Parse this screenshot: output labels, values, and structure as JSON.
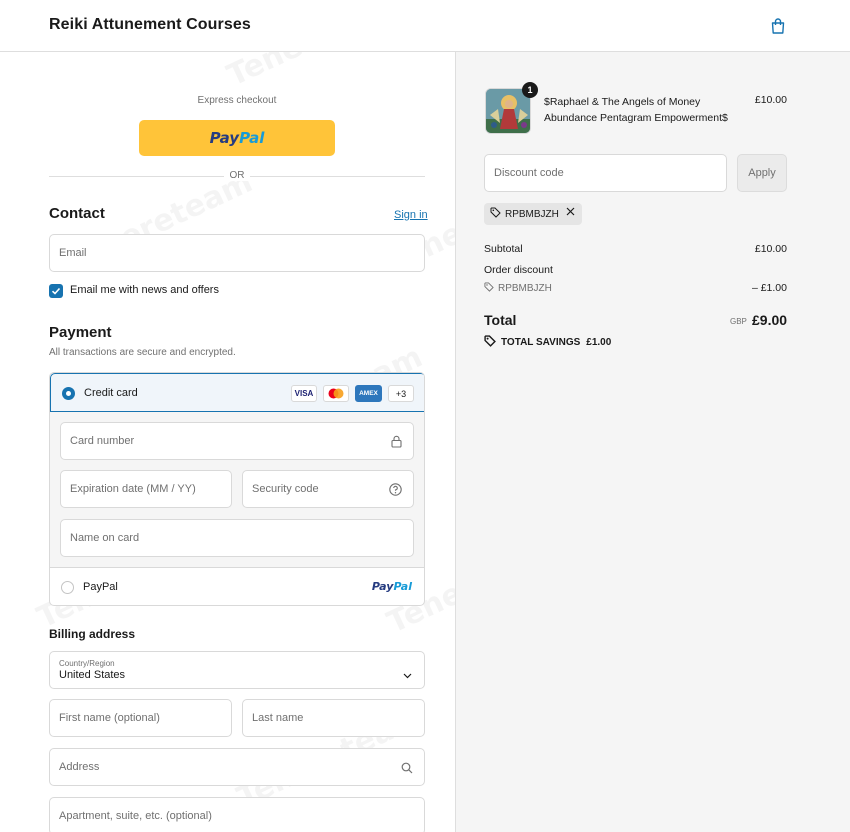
{
  "header": {
    "store_title": "Reiki Attunement Courses",
    "cart_icon": "shopping-bag-icon"
  },
  "express": {
    "label": "Express checkout",
    "paypal_part1": "Pay",
    "paypal_part2": "Pal",
    "or_text": "OR"
  },
  "contact": {
    "heading": "Contact",
    "signin_label": "Sign in",
    "email_placeholder": "Email",
    "newsletter_label": "Email me with news and offers",
    "newsletter_checked": true
  },
  "payment": {
    "heading": "Payment",
    "subtitle": "All transactions are secure and encrypted.",
    "credit_card_label": "Credit card",
    "card_logos": [
      "VISA",
      "AMEX"
    ],
    "more_cards": "+3",
    "card_number_placeholder": "Card number",
    "expiry_placeholder": "Expiration date (MM / YY)",
    "security_placeholder": "Security code",
    "name_placeholder": "Name on card",
    "paypal_label": "PayPal",
    "paypal_logo_part1": "Pay",
    "paypal_logo_part2": "Pal"
  },
  "billing": {
    "heading": "Billing address",
    "country_label": "Country/Region",
    "country_value": "United States",
    "first_name_placeholder": "First name (optional)",
    "last_name_placeholder": "Last name",
    "address_placeholder": "Address",
    "apartment_placeholder": "Apartment, suite, etc. (optional)"
  },
  "order": {
    "quantity": "1",
    "product_name": "$Raphael & The Angels of Money Abundance Pentagram Empowerment$",
    "product_price": "£10.00",
    "discount_placeholder": "Discount code",
    "apply_label": "Apply",
    "applied_code": "RPBMBJZH",
    "subtotal_label": "Subtotal",
    "subtotal_value": "£10.00",
    "order_discount_label": "Order discount",
    "discount_code_line": "RPBMBJZH",
    "discount_value": "– £1.00",
    "total_label": "Total",
    "total_currency": "GBP",
    "total_value": "£9.00",
    "savings_label": "TOTAL SAVINGS",
    "savings_value": "£1.00"
  },
  "colors": {
    "accent": "#1773b0",
    "paypal_yellow": "#ffc439",
    "paypal_dark": "#253b80",
    "paypal_light": "#179bd7",
    "summary_bg": "#f5f5f5"
  }
}
